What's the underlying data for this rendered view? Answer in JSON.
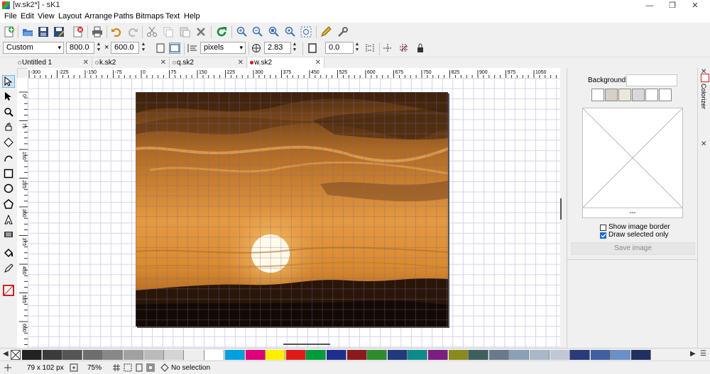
{
  "window": {
    "title": "[w.sk2*] - sK1",
    "minimize": "—",
    "maximize": "❐",
    "close": "✕"
  },
  "menu": [
    "File",
    "Edit",
    "View",
    "Layout",
    "Arrange",
    "Paths",
    "Bitmaps",
    "Text",
    "Help"
  ],
  "page_props": {
    "page_format": "Custom",
    "width": "800.0",
    "times": "×",
    "height": "600.0",
    "units": "pixels",
    "nudge": "2.83",
    "angle": "0.0"
  },
  "tabs": [
    {
      "label": "Untitled 1",
      "close": "✕"
    },
    {
      "label": "k.sk2",
      "close": "✕"
    },
    {
      "label": "q.sk2",
      "close": "✕"
    },
    {
      "label": "w.sk2",
      "close": "✕"
    }
  ],
  "rulers": {
    "h_labels": [
      "-300",
      "-225",
      "-150",
      "-75",
      "0",
      "75",
      "150",
      "225",
      "300",
      "375",
      "450",
      "525",
      "600",
      "675",
      "750",
      "825",
      "900",
      "975",
      "1050"
    ],
    "v_labels": [
      "0",
      "75",
      "150",
      "225",
      "300",
      "375",
      "450",
      "525",
      "600"
    ]
  },
  "colors": {
    "accent": "#1a6fd6",
    "active_tab_dot": "#dd1111"
  },
  "right_panel": {
    "background_label": "Background:",
    "preview_caption": "---",
    "show_border_label": "Show image border",
    "show_border_checked": false,
    "draw_selected_label": "Draw selected only",
    "draw_selected_checked": true,
    "save_button": "Save image",
    "side_tab": "Colorizer",
    "swatch_colors": [
      "#ffffff",
      "#d6d0c8",
      "#ece8d8",
      "#d8d8dc",
      "#ffffff",
      "#ffffff"
    ]
  },
  "palette": {
    "colors": [
      "#222222",
      "#3b3b3b",
      "#555555",
      "#6e6e6e",
      "#888888",
      "#a1a1a1",
      "#bbbbbb",
      "#d4d4d4",
      "#eeeeee",
      "#ffffff",
      "#00a0e0",
      "#e0007a",
      "#ffee00",
      "#e01a1a",
      "#009b3a",
      "#1f2f8f",
      "#8b1a1a",
      "#2e8b2e",
      "#203a7a",
      "#0f8a8a",
      "#7a1f7f",
      "#8a8a1f",
      "#3f5f5f",
      "#6a7a8a",
      "#8aa0b8",
      "#a8b8c8",
      "#c0c8d8",
      "#2a3a7a",
      "#3f5fa0",
      "#6a90c8",
      "#203060"
    ]
  },
  "status": {
    "cursor": "79 x 102 px",
    "zoom": "75%",
    "selection": "No selection"
  }
}
